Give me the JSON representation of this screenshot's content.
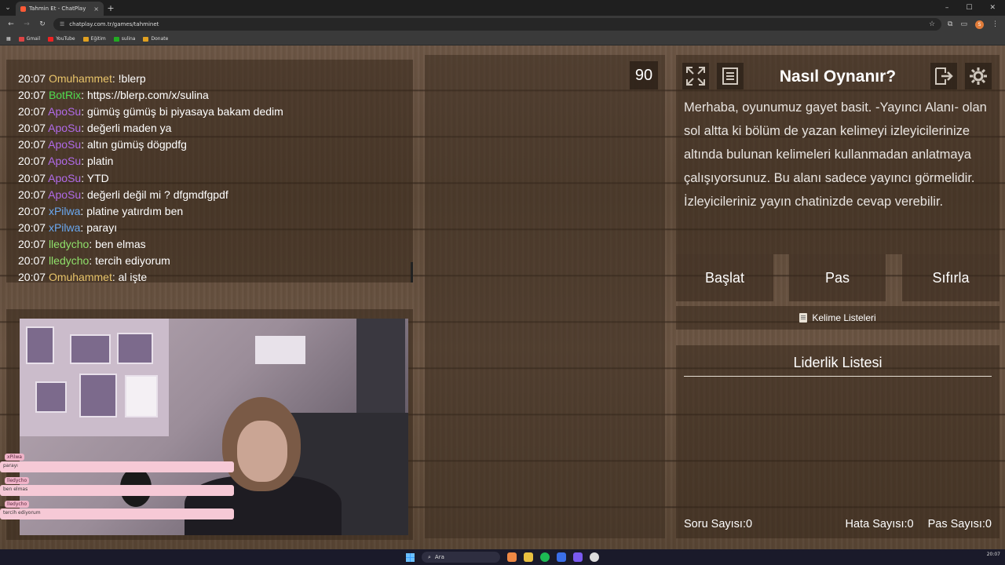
{
  "browser": {
    "tab_title": "Tahmin Et - ChatPlay",
    "url": "chatplay.com.tr/games/tahminet",
    "bookmarks": [
      {
        "label": "Gmail",
        "color": "#d44"
      },
      {
        "label": "YouTube",
        "color": "#e22"
      },
      {
        "label": "Eğitim",
        "color": "#e0a020"
      },
      {
        "label": "sulina",
        "color": "#2a2"
      },
      {
        "label": "Donate",
        "color": "#e0a020"
      }
    ],
    "profile_initial": "S"
  },
  "chat": {
    "messages": [
      {
        "time": "20:07",
        "user": "Omuhammet",
        "color": "#e8c46a",
        "text": "!blerp"
      },
      {
        "time": "20:07",
        "user": "BotRix",
        "color": "#4fdc4f",
        "text": "https://blerp.com/x/sulina"
      },
      {
        "time": "20:07",
        "user": "ApoSu",
        "color": "#b06ae8",
        "text": "gümüş gümüş bi piyasaya bakam dedim"
      },
      {
        "time": "20:07",
        "user": "ApoSu",
        "color": "#b06ae8",
        "text": "değerli maden ya"
      },
      {
        "time": "20:07",
        "user": "ApoSu",
        "color": "#b06ae8",
        "text": "altın gümüş dögpdfg"
      },
      {
        "time": "20:07",
        "user": "ApoSu",
        "color": "#b06ae8",
        "text": "platin"
      },
      {
        "time": "20:07",
        "user": "ApoSu",
        "color": "#b06ae8",
        "text": "YTD"
      },
      {
        "time": "20:07",
        "user": "ApoSu",
        "color": "#b06ae8",
        "text": "değerli değil mi ? dfgmdfgpdf"
      },
      {
        "time": "20:07",
        "user": "xPilwa",
        "color": "#6aa8f0",
        "text": "platine yatırdım ben"
      },
      {
        "time": "20:07",
        "user": "xPilwa",
        "color": "#6aa8f0",
        "text": "parayı"
      },
      {
        "time": "20:07",
        "user": "lledycho",
        "color": "#8fe06a",
        "text": "ben elmas"
      },
      {
        "time": "20:07",
        "user": "lledycho",
        "color": "#8fe06a",
        "text": "tercih ediyorum"
      },
      {
        "time": "20:07",
        "user": "Omuhammet",
        "color": "#e8c46a",
        "text": "al işte"
      }
    ]
  },
  "game": {
    "timer": "90"
  },
  "howto": {
    "title": "Nasıl Oynanır?",
    "text": "Merhaba, oyunumuz gayet basit. -Yayıncı Alanı- olan sol altta ki bölüm de yazan kelimeyi izleyicilerinize altında bulunan kelimeleri kullanmadan anlatmaya çalışıyorsunuz. Bu alanı sadece yayıncı görmelidir. İzleyicileriniz yayın chatinizde cevap verebilir."
  },
  "controls": {
    "start": "Başlat",
    "pass": "Pas",
    "reset": "Sıfırla",
    "word_lists": "Kelime Listeleri"
  },
  "leaderboard": {
    "title": "Liderlik Listesi",
    "questions": "Soru Sayısı:0",
    "errors": "Hata Sayısı:0",
    "passes": "Pas Sayısı:0"
  },
  "overlay": {
    "items": [
      {
        "name": "xPilwa",
        "text": "parayı"
      },
      {
        "name": "lledycho",
        "text": "ben elmas"
      },
      {
        "name": "lledycho",
        "text": "tercih ediyorum"
      }
    ]
  },
  "taskbar": {
    "search": "Ara",
    "time": "20:07"
  }
}
